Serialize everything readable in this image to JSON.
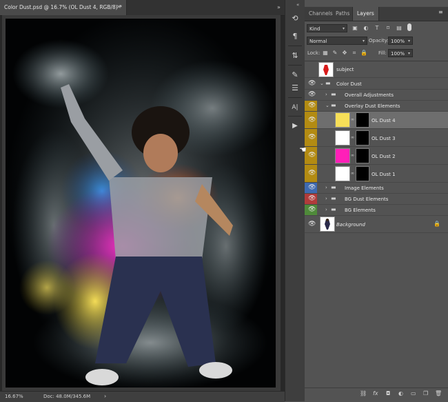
{
  "document": {
    "tab_title": "Color Dust.psd @ 16.7% (OL Dust 4, RGB/8) *",
    "close": "×",
    "collapse": "»"
  },
  "status": {
    "zoom": "16.67%",
    "doc_size": "Doc: 48.0M/345.6M",
    "arrow": "›"
  },
  "toolstrip": {
    "collapse": "«",
    "tools": [
      {
        "icon": "history-brush-icon",
        "glyph": "⟲"
      },
      {
        "icon": "paragraph-icon",
        "glyph": "¶"
      },
      {
        "icon": "transform-icon",
        "glyph": "⇅"
      },
      {
        "icon": "brush-settings-icon",
        "glyph": "✎"
      },
      {
        "icon": "adjustments-icon",
        "glyph": "☰"
      },
      {
        "icon": "character-icon",
        "glyph": "A|"
      },
      {
        "icon": "play-action-icon",
        "glyph": "▶"
      }
    ]
  },
  "panel": {
    "tabs": [
      "Channels",
      "Paths",
      "Layers"
    ],
    "menu": "≡",
    "filter_kind": "Kind",
    "blend_mode": "Normal",
    "opacity_label": "Opacity:",
    "opacity_value": "100%",
    "lock_label": "Lock:",
    "fill_label": "Fill:",
    "fill_value": "100%"
  },
  "layers": [
    {
      "name": "subject",
      "type": "image",
      "visible": false,
      "tag": null,
      "italic": false
    },
    {
      "name": "Color Dust",
      "type": "group",
      "visible": true,
      "tag": null,
      "expanded": true,
      "indent": 0
    },
    {
      "name": "Overall Adjustments",
      "type": "group",
      "visible": true,
      "tag": null,
      "expanded": false,
      "indent": 1
    },
    {
      "name": "Overlay Dust Elements",
      "type": "group",
      "visible": true,
      "tag": "#b38b12",
      "expanded": true,
      "indent": 1
    },
    {
      "name": "OL Dust 4",
      "type": "fill",
      "visible": true,
      "tag": "#b38b12",
      "color": "#f7df58",
      "selected": true
    },
    {
      "name": "OL Dust 3",
      "type": "fill",
      "visible": true,
      "tag": "#b38b12",
      "color": "#ffffff"
    },
    {
      "name": "OL Dust 2",
      "type": "fill",
      "visible": true,
      "tag": "#b38b12",
      "color": "#ff1fb8"
    },
    {
      "name": "OL Dust 1",
      "type": "fill",
      "visible": true,
      "tag": "#b38b12",
      "color": "#ffffff"
    },
    {
      "name": "Image Elements",
      "type": "group",
      "visible": true,
      "tag": "#3f6ab0",
      "expanded": false,
      "indent": 1
    },
    {
      "name": "BG Dust Elements",
      "type": "group",
      "visible": true,
      "tag": "#b13b3b",
      "expanded": false,
      "indent": 1
    },
    {
      "name": "BG Elements",
      "type": "group",
      "visible": true,
      "tag": "#4f8a3a",
      "expanded": false,
      "indent": 1
    },
    {
      "name": "Background",
      "type": "background",
      "visible": true,
      "tag": null,
      "italic": true,
      "locked": true
    }
  ],
  "bottom_icons": [
    "link-layers-icon",
    "fx-icon",
    "add-mask-icon",
    "adjustment-layer-icon",
    "new-group-icon",
    "new-layer-icon",
    "delete-layer-icon"
  ],
  "bottom_glyphs": [
    "⛓",
    "fx",
    "◘",
    "◐",
    "▭",
    "❐",
    "🗑"
  ]
}
